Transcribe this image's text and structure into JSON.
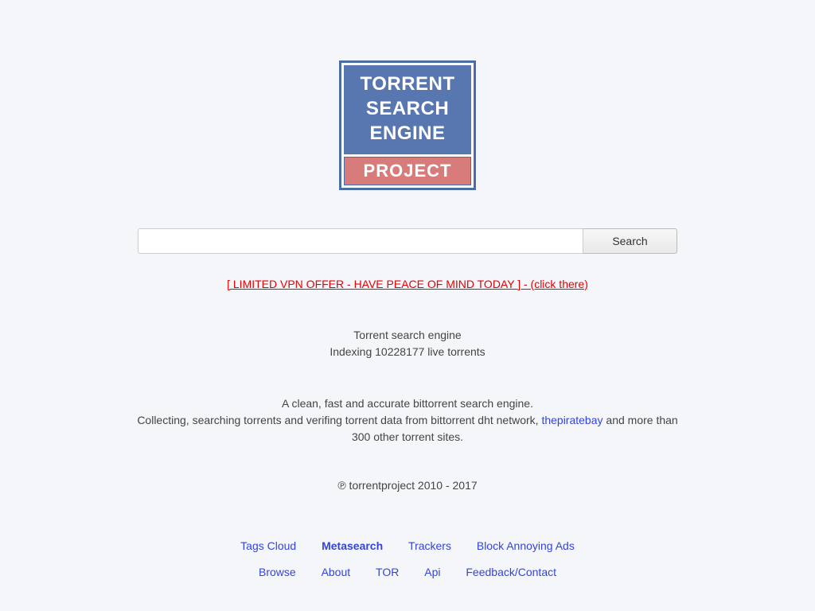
{
  "logo": {
    "line1": "TORRENT",
    "line2": "SEARCH",
    "line3": "ENGINE",
    "line4": "PROJECT"
  },
  "search": {
    "value": "",
    "placeholder": "",
    "button": "Search"
  },
  "vpn_offer": "[ LIMITED VPN OFFER - HAVE PEACE OF MIND TODAY ] - (click there)",
  "tagline": {
    "line1": "Torrent search engine",
    "line2": "Indexing 10228177 live torrents"
  },
  "desc": {
    "line1": "A clean, fast and accurate bittorrent search engine.",
    "line2a": "Collecting, searching torrents and verifing torrent data from bittorrent dht network, ",
    "link": "thepiratebay",
    "line2b": " and more than 300 other torrent sites."
  },
  "copyright": "℗ torrentproject 2010 - 2017",
  "nav": {
    "row1": [
      {
        "label": "Tags Cloud",
        "active": false
      },
      {
        "label": "Metasearch",
        "active": true
      },
      {
        "label": "Trackers",
        "active": false
      },
      {
        "label": "Block Annoying Ads",
        "active": false
      }
    ],
    "row2": [
      {
        "label": "Browse"
      },
      {
        "label": "About"
      },
      {
        "label": "TOR"
      },
      {
        "label": "Api"
      },
      {
        "label": "Feedback/Contact"
      }
    ]
  }
}
